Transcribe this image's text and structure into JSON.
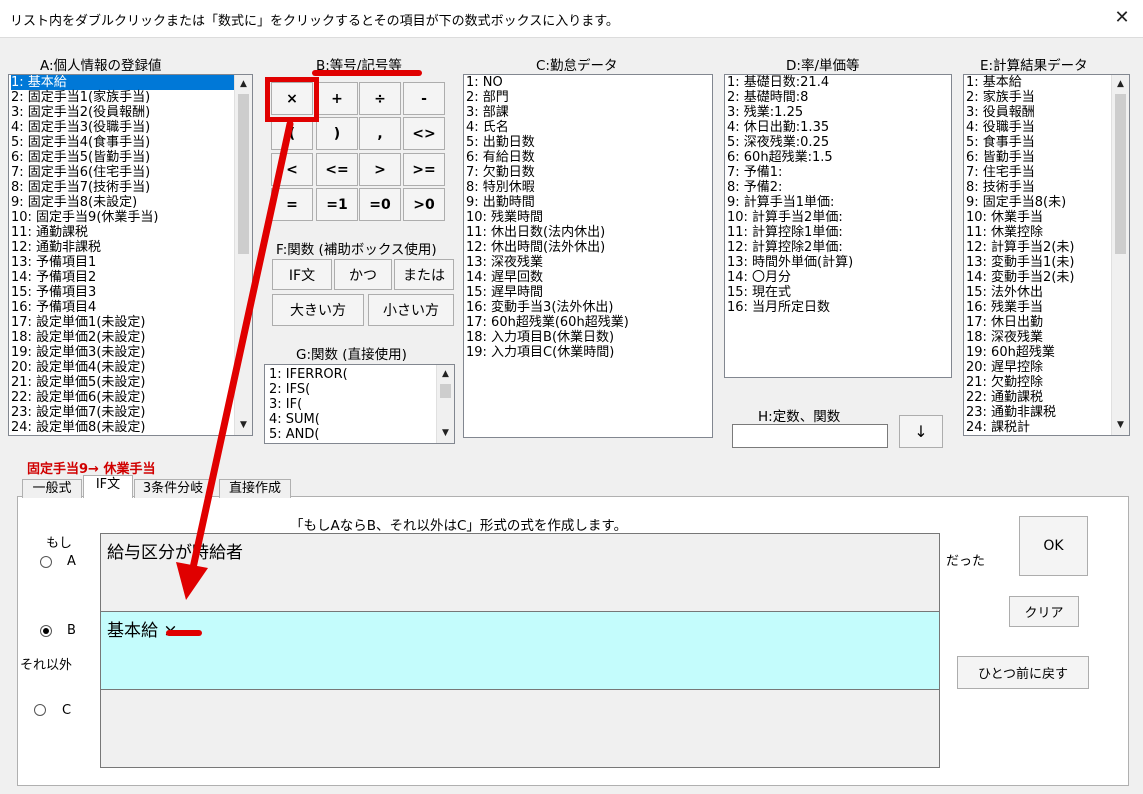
{
  "window": {
    "title": "リスト内をダブルクリックまたは「数式に」をクリックするとその項目が下の数式ボックスに入ります。",
    "close_glyph": "✕"
  },
  "listA": {
    "header": "A:個人情報の登録値",
    "items": [
      "1: 基本給",
      "2: 固定手当1(家族手当)",
      "3: 固定手当2(役員報酬)",
      "4: 固定手当3(役職手当)",
      "5: 固定手当4(食事手当)",
      "6: 固定手当5(皆勤手当)",
      "7: 固定手当6(住宅手当)",
      "8: 固定手当7(技術手当)",
      "9: 固定手当8(未設定)",
      "10: 固定手当9(休業手当)",
      "11: 通勤課税",
      "12: 通勤非課税",
      "13: 予備項目1",
      "14: 予備項目2",
      "15: 予備項目3",
      "16: 予備項目4",
      "17: 設定単価1(未設定)",
      "18: 設定単価2(未設定)",
      "19: 設定単価3(未設定)",
      "20: 設定単価4(未設定)",
      "21: 設定単価5(未設定)",
      "22: 設定単価6(未設定)",
      "23: 設定単価7(未設定)",
      "24: 設定単価8(未設定)"
    ]
  },
  "groupB": {
    "header": "B:等号/記号等",
    "buttons": [
      "×",
      "+",
      "÷",
      "-",
      "(",
      ")",
      ",",
      "<>",
      "<",
      "<=",
      ">",
      ">=",
      "=",
      "=1",
      "=0",
      ">0"
    ]
  },
  "groupF": {
    "header": "F:関数 (補助ボックス使用)",
    "buttons": [
      "IF文",
      "かつ",
      "または",
      "大きい方",
      "小さい方"
    ]
  },
  "listG": {
    "header": "G:関数 (直接使用)",
    "items": [
      "1: IFERROR(",
      "2: IFS(",
      "3: IF(",
      "4: SUM(",
      "5: AND("
    ]
  },
  "listC": {
    "header": "C:勤怠データ",
    "items": [
      "1: NO",
      "2: 部門",
      "3: 部課",
      "4: 氏名",
      "5: 出勤日数",
      "6: 有給日数",
      "7: 欠勤日数",
      "8: 特別休暇",
      "9: 出勤時間",
      "10: 残業時間",
      "11: 休出日数(法内休出)",
      "12: 休出時間(法外休出)",
      "13: 深夜残業",
      "14: 遅早回数",
      "15: 遅早時間",
      "16: 変動手当3(法外休出)",
      "17: 60h超残業(60h超残業)",
      "18: 入力項目B(休業日数)",
      "19: 入力項目C(休業時間)"
    ]
  },
  "listD": {
    "header": "D:率/単価等",
    "items": [
      "1: 基礎日数:21.4",
      "2: 基礎時間:8",
      "3: 残業:1.25",
      "4: 休日出勤:1.35",
      "5: 深夜残業:0.25",
      "6: 60h超残業:1.5",
      "7: 予備1:",
      "8: 予備2:",
      "9: 計算手当1単価:",
      "10: 計算手当2単価:",
      "11: 計算控除1単価:",
      "12: 計算控除2単価:",
      "13: 時間外単価(計算)",
      "14: 〇月分",
      "15: 現在式",
      "16: 当月所定日数"
    ]
  },
  "groupH": {
    "header": "H:定数、関数",
    "input_value": "",
    "down_glyph": "↓"
  },
  "listE": {
    "header": "E:計算結果データ",
    "items": [
      "1: 基本給",
      "2: 家族手当",
      "3: 役員報酬",
      "4: 役職手当",
      "5: 食事手当",
      "6: 皆勤手当",
      "7: 住宅手当",
      "8: 技術手当",
      "9: 固定手当8(未)",
      "10: 休業手当",
      "11: 休業控除",
      "12: 計算手当2(未)",
      "13: 変動手当1(未)",
      "14: 変動手当2(未)",
      "15: 法外休出",
      "16: 残業手当",
      "17: 休日出勤",
      "18: 深夜残業",
      "19: 60h超残業",
      "20: 遅早控除",
      "21: 欠勤控除",
      "22: 通勤課税",
      "23: 通勤非課税",
      "24: 課税計"
    ]
  },
  "status": {
    "selected": "固定手当9→ 休業手当"
  },
  "tabs": [
    "一般式",
    "IF文",
    "3条件分岐",
    "直接作成"
  ],
  "ifpanel": {
    "instruction": "「もしAならB、それ以外はC」形式の式を作成します。",
    "label_if": "もし",
    "label_else": "それ以外",
    "radio_a": "A",
    "radio_b": "B",
    "radio_c": "C",
    "box_a": "給与区分が時給者",
    "box_b": "基本給 ×",
    "box_c": "",
    "suffix": "だった"
  },
  "actions": {
    "ok": "OK",
    "clear": "クリア",
    "undo": "ひとつ前に戻す"
  },
  "colors": {
    "selection": "#0078d7",
    "box_b_bg": "#c4fcfc",
    "annotation": "#e00000",
    "status_text": "#d00000"
  }
}
